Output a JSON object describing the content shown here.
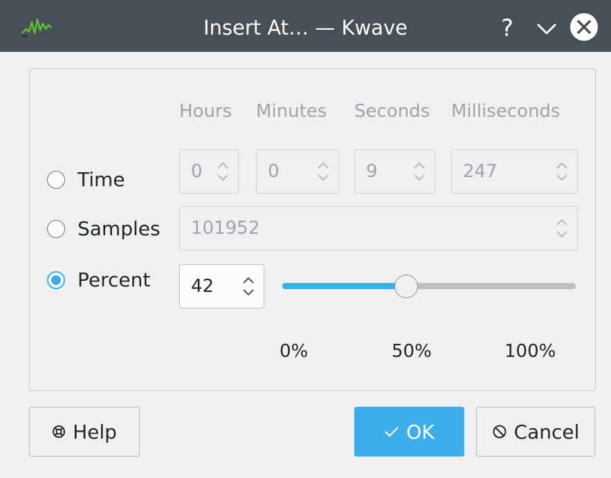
{
  "window": {
    "title": "Insert At… — Kwave",
    "app_icon": "kwave-waveform-icon",
    "help_glyph": "?",
    "controls": [
      "help-icon",
      "minimize-icon",
      "close-icon"
    ]
  },
  "columns": {
    "hours": "Hours",
    "minutes": "Minutes",
    "seconds": "Seconds",
    "milliseconds": "Milliseconds"
  },
  "time": {
    "label": "Time",
    "selected": false,
    "hours": "0",
    "minutes": "0",
    "seconds": "9",
    "milliseconds": "247"
  },
  "samples": {
    "label": "Samples",
    "selected": false,
    "value": "101952"
  },
  "percent": {
    "label": "Percent",
    "selected": true,
    "value": "42",
    "slider_fraction": 0.42,
    "ticks": [
      "0%",
      "50%",
      "100%"
    ]
  },
  "buttons": {
    "help": "Help",
    "ok": "OK",
    "cancel": "Cancel"
  },
  "colors": {
    "accent": "#3daee9",
    "titlebar": "#475057",
    "window_bg": "#eff0f1",
    "disabled_text": "#a0a4a8"
  }
}
